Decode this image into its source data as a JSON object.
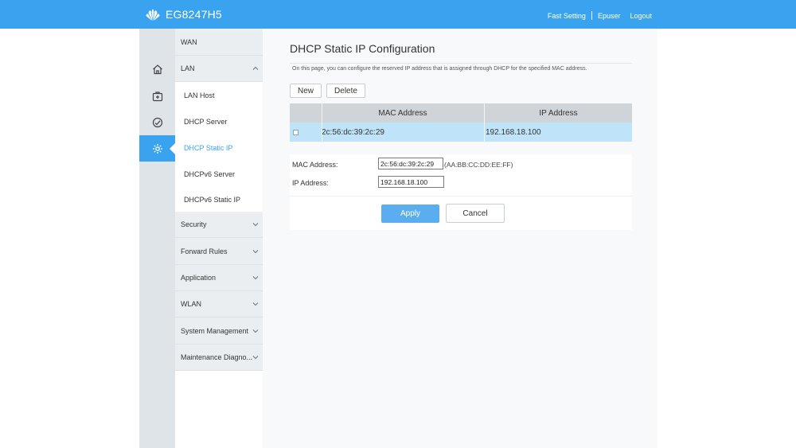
{
  "header": {
    "brand": "EG8247H5",
    "links": {
      "fast_setting": "Fast Setting",
      "user": "Epuser",
      "logout": "Logout"
    }
  },
  "iconbar": {
    "items": [
      {
        "icon": "home-icon"
      },
      {
        "icon": "medical-kit-icon"
      },
      {
        "icon": "status-check-icon"
      },
      {
        "icon": "gear-icon",
        "active": true
      }
    ]
  },
  "menu": {
    "wan": "WAN",
    "lan": "LAN",
    "lan_sub": [
      "LAN Host",
      "DHCP Server",
      "DHCP Static IP",
      "DHCPv6 Server",
      "DHCPv6 Static IP"
    ],
    "security": "Security",
    "forward_rules": "Forward Rules",
    "application": "Application",
    "wlan": "WLAN",
    "system_management": "System Management",
    "maintenance": "Maintenance Diagno..."
  },
  "main": {
    "title": "DHCP Static IP Configuration",
    "description": "On this page, you can configure the reserved IP address that is assigned through DHCP for the specified MAC address.",
    "new_button": "New",
    "delete_button": "Delete",
    "table": {
      "headers": [
        "MAC Address",
        "IP Address"
      ],
      "rows": [
        {
          "mac": "2c:56:dc:39:2c:29",
          "ip": "192.168.18.100"
        }
      ]
    },
    "form": {
      "mac_label": "MAC Address:",
      "mac_value": "2c:56:dc:39:2c:29",
      "mac_hint": "(AA:BB:CC:DD:EE:FF)",
      "ip_label": "IP Address:",
      "ip_value": "192.168.18.100"
    },
    "apply_button": "Apply",
    "cancel_button": "Cancel"
  },
  "colors": {
    "accent": "#3aa3f0",
    "selected_row": "#bfe3f9",
    "apply": "#5aaef0"
  }
}
